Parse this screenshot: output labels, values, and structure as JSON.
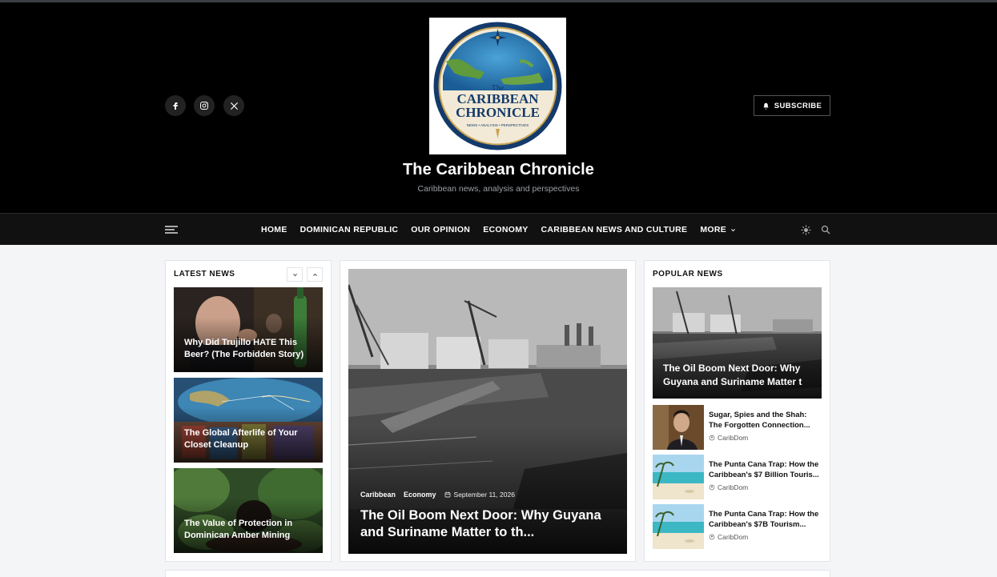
{
  "header": {
    "logo_text": {
      "line1": "The",
      "line2": "CARIBBEAN",
      "line3": "CHRONICLE",
      "subline": "NEWS • ANALYSIS • PERSPECTIVES",
      "ring": "COVERING OUR REGION, TELLING OUR STORIES"
    },
    "site_title": "The Caribbean Chronicle",
    "tagline": "Caribbean news, analysis and perspectives",
    "subscribe_label": "SUBSCRIBE",
    "social": [
      "facebook-icon",
      "instagram-icon",
      "x-icon"
    ]
  },
  "nav": {
    "items": [
      "HOME",
      "DOMINICAN REPUBLIC",
      "OUR OPINION",
      "ECONOMY",
      "CARIBBEAN NEWS AND CULTURE",
      "MORE"
    ]
  },
  "latest": {
    "title": "LATEST NEWS",
    "items": [
      "Why Did Trujillo HATE This Beer? (The Forbidden Story)",
      "The Global Afterlife of Your Closet Cleanup",
      "The Value of Protection in Dominican Amber Mining"
    ]
  },
  "featured": {
    "categories": [
      "Caribbean",
      "Economy"
    ],
    "date": "September 11, 2026",
    "headline": "The Oil Boom Next Door: Why Guyana and Suriname Matter to th..."
  },
  "popular": {
    "title": "POPULAR NEWS",
    "feature_title": "The Oil Boom Next Door: Why Guyana and Suriname Matter t",
    "items": [
      {
        "title": "Sugar, Spies and the Shah: The Forgotten Connection...",
        "author": "CaribDom"
      },
      {
        "title": "The Punta Cana Trap: How the Caribbean's $7 Billion Touris...",
        "author": "CaribDom"
      },
      {
        "title": "The Punta Cana Trap: How the Caribbean's $7B Tourism...",
        "author": "CaribDom"
      }
    ]
  },
  "colors": {
    "header_bg": "#000000",
    "nav_bg": "#111111",
    "page_bg": "#f3f5f7"
  }
}
